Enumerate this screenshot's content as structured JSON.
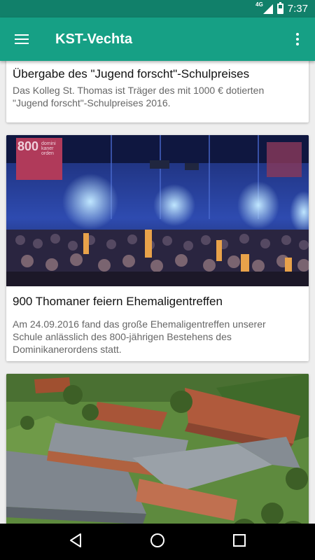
{
  "status_bar": {
    "network": "4G",
    "time": "7:37"
  },
  "app_bar": {
    "title": "KST-Vechta"
  },
  "colors": {
    "status_bar": "#11806a",
    "app_bar": "#16a085",
    "background": "#eeeeee"
  },
  "articles": [
    {
      "title": "Übergabe des \"Jugend forscht\"-Schulpreises",
      "summary": "Das Kolleg St. Thomas ist Träger des mit 1000 € dotierten \"Jugend forscht\"-Schulpreises 2016."
    },
    {
      "title": "900 Thomaner feiern Ehemaligentreffen",
      "summary": "Am 24.09.2016 fand das große Ehemaligentreffen unserer Schule anlässlich des 800-jährigen Bestehens des Dominikanerordens statt.",
      "image": "event-hall-photo",
      "banner_text": [
        "800",
        "domini",
        "kaner",
        "orden"
      ]
    },
    {
      "image": "campus-aerial-photo"
    }
  ],
  "nav_bar": {
    "icons": [
      "back-icon",
      "home-icon",
      "recents-icon"
    ]
  }
}
